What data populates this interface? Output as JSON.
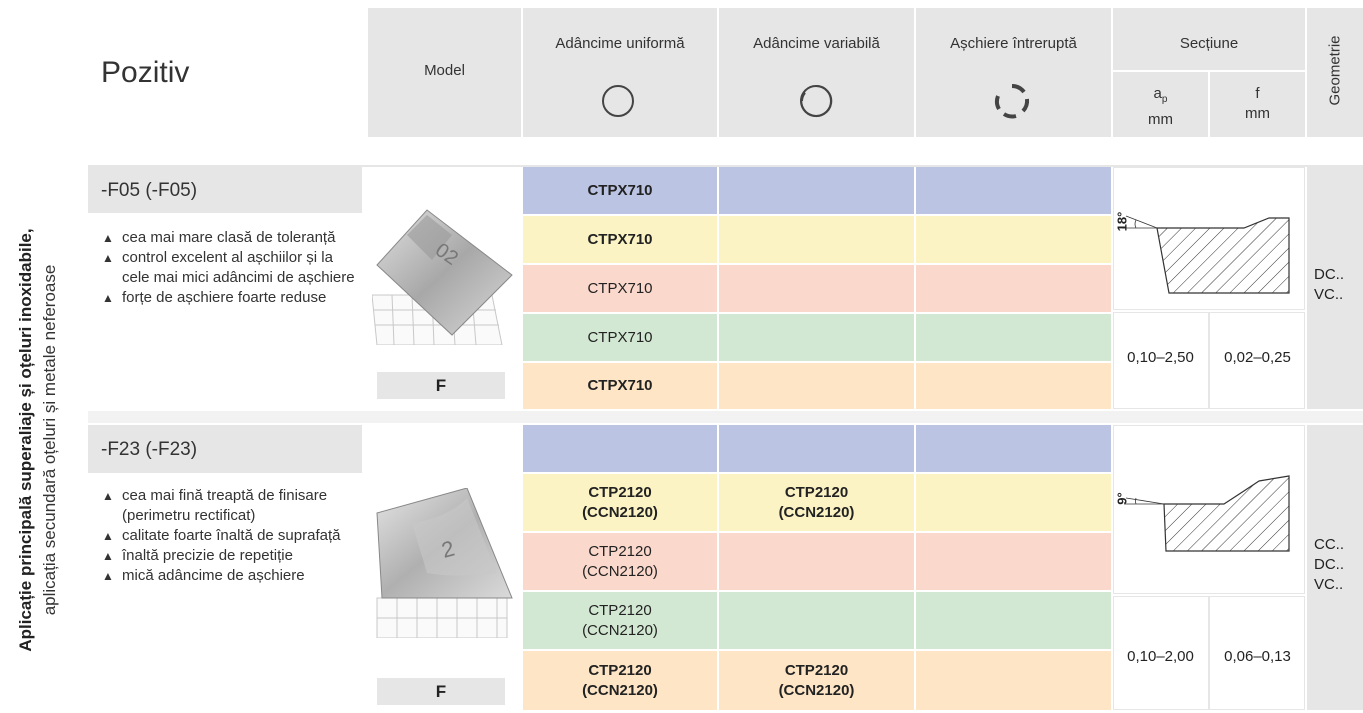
{
  "header": {
    "title": "Pozitiv",
    "model": "Model",
    "col1": "Adâncime uniformă",
    "col2": "Adâncime variabilă",
    "col3": "Așchiere întreruptă",
    "section": "Secțiune",
    "ap_sym": "a",
    "ap_sub": "p",
    "ap_unit": "mm",
    "f_sym": "f",
    "f_unit": "mm",
    "geometry": "Geometrie"
  },
  "side": {
    "main": "Aplicație principală superaliaje și oțeluri inoxidabile,",
    "secondary": "aplicația secundară oțeluri și metale neferoase"
  },
  "groups": [
    {
      "name": "-F05 (-F05)",
      "features": [
        "cea mai mare clasă de toleranță",
        "control excelent al așchiilor și la cele mai mici adâncimi de așchiere",
        "forțe de așchiere foarte reduse"
      ],
      "insert_label": "F",
      "angle": "18°",
      "ap": "0,10–2,50",
      "f": "0,02–0,25",
      "geometry": [
        "DC..",
        "VC.."
      ],
      "rows": [
        [
          "CTPX710",
          "",
          ""
        ],
        [
          "CTPX710",
          "",
          ""
        ],
        [
          "CTPX710",
          "",
          ""
        ],
        [
          "CTPX710",
          "",
          ""
        ],
        [
          "CTPX710",
          "",
          ""
        ]
      ]
    },
    {
      "name": "-F23 (-F23)",
      "features": [
        "cea mai fină treaptă de finisare (perimetru rectificat)",
        "calitate foarte înaltă de suprafață",
        "înaltă precizie de repetiție",
        "mică adâncime de așchiere"
      ],
      "insert_label": "F",
      "angle": "9°",
      "ap": "0,10–2,00",
      "f": "0,06–0,13",
      "geometry": [
        "CC..",
        "DC..",
        "VC.."
      ],
      "rows": [
        [
          "",
          "",
          ""
        ],
        [
          "CTP2120",
          "CTP2120",
          ""
        ],
        [
          "CTP2120",
          "",
          ""
        ],
        [
          "CTP2120",
          "",
          ""
        ],
        [
          "CTP2120",
          "CTP2120",
          ""
        ]
      ],
      "rows_sub": [
        [
          "",
          "",
          ""
        ],
        [
          "(CCN2120)",
          "(CCN2120)",
          ""
        ],
        [
          "(CCN2120)",
          "",
          ""
        ],
        [
          "(CCN2120)",
          "",
          ""
        ],
        [
          "(CCN2120)",
          "(CCN2120)",
          ""
        ]
      ]
    }
  ]
}
